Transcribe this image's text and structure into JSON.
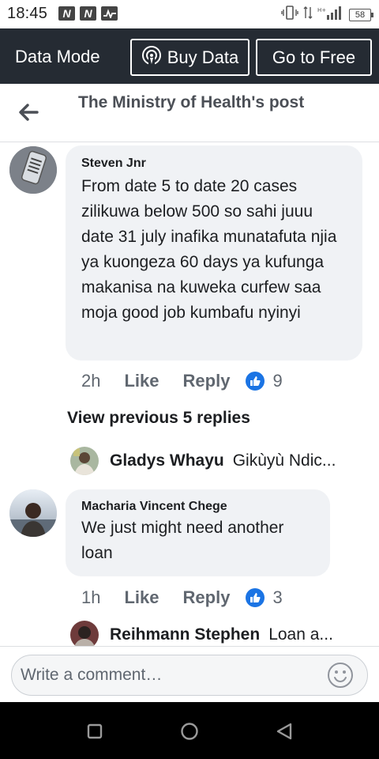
{
  "status_bar": {
    "time": "18:45",
    "left_icons": [
      "N",
      "N",
      "activity-icon"
    ],
    "battery": "58"
  },
  "data_bar": {
    "mode_label": "Data Mode",
    "buy_data_label": "Buy Data",
    "go_free_label": "Go to Free"
  },
  "header": {
    "title": "The Ministry of Health's post"
  },
  "comments": [
    {
      "author": "Steven Jnr",
      "text": "From date 5 to date 20 cases zilikuwa below 500 so sahi juuu date 31 july inafika munatafuta njia ya kuongeza 60 days ya kufunga makanisa na kuweka curfew saa moja good job kumbafu nyinyi",
      "time": "2h",
      "like_label": "Like",
      "reply_label": "Reply",
      "reactions": "9",
      "view_previous": "View previous 5 replies",
      "reply_preview": {
        "author": "Gladys Whayu",
        "text": "Gikùyù Ndic..."
      }
    },
    {
      "author": "Macharia Vincent Chege",
      "text": "We just might need another loan",
      "time": "1h",
      "like_label": "Like",
      "reply_label": "Reply",
      "reactions": "3",
      "reply_preview": {
        "author": "Reihmann Stephen",
        "text": "Loan a..."
      }
    }
  ],
  "composer": {
    "placeholder": "Write a comment…"
  },
  "colors": {
    "data_bar_bg": "#252b33",
    "bubble_bg": "#f0f2f5",
    "like_blue": "#1b74e4"
  }
}
